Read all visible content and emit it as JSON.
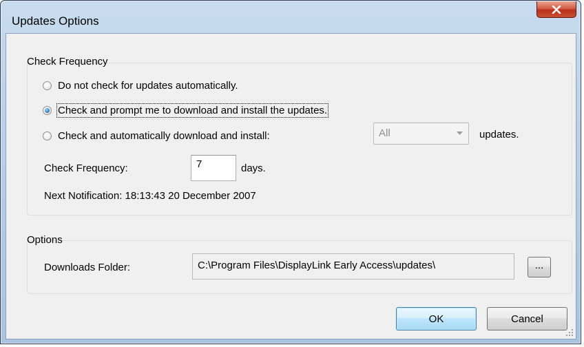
{
  "window": {
    "title": "Updates Options"
  },
  "frequency_group": {
    "title": "Check Frequency",
    "options": [
      {
        "label": "Do not check for updates automatically.",
        "checked": false
      },
      {
        "label": "Check and prompt me to download and install the updates.",
        "checked": true
      },
      {
        "label": "Check and automatically download and install:",
        "checked": false
      }
    ],
    "update_type": {
      "value": "All"
    },
    "updates_suffix": "updates.",
    "frequency_label": "Check Frequency:",
    "frequency_value": "7",
    "frequency_unit": "days.",
    "next_notification": "Next Notification: 18:13:43 20 December 2007"
  },
  "options_group": {
    "title": "Options",
    "downloads_label": "Downloads Folder:",
    "downloads_path": "C:\\Program Files\\DisplayLink Early Access\\updates\\",
    "browse_label": "..."
  },
  "buttons": {
    "ok": "OK",
    "cancel": "Cancel"
  },
  "icons": {
    "close": "close-icon",
    "dropdown": "chevron-down-icon",
    "grip": "resize-grip-icon"
  }
}
